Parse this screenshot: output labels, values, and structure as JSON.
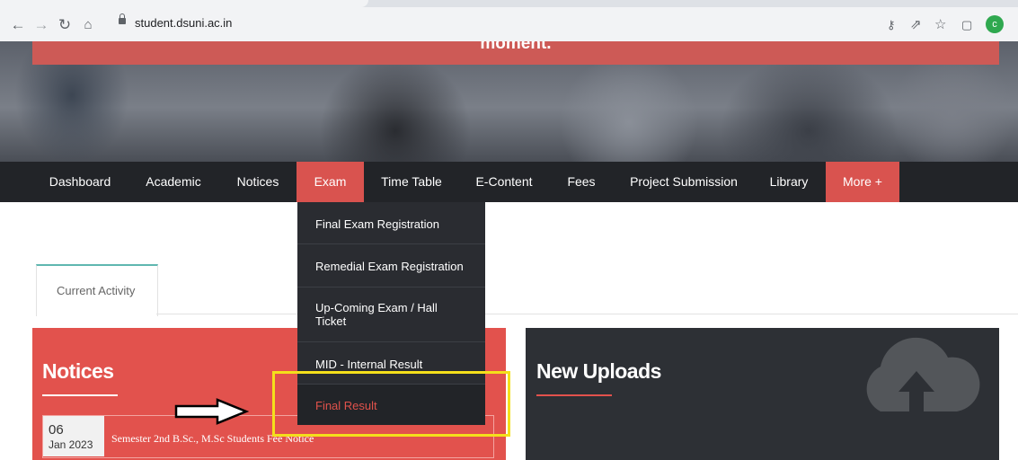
{
  "browser": {
    "url": "student.dsuni.ac.in",
    "nav_icons": [
      "back-arrow-icon",
      "forward-arrow-icon",
      "reload-icon",
      "home-icon"
    ],
    "right_icons": [
      "key-icon",
      "share-icon",
      "star-icon",
      "side-panel-icon"
    ],
    "profile_initial": "c"
  },
  "hero": {
    "title": "moment."
  },
  "nav": {
    "items": [
      "Dashboard",
      "Academic",
      "Notices",
      "Exam",
      "Time Table",
      "E-Content",
      "Fees",
      "Project Submission",
      "Library",
      "More +"
    ],
    "active": "Exam"
  },
  "exam_menu": {
    "items": [
      "Final Exam Registration",
      "Remedial Exam Registration",
      "Up-Coming Exam / Hall",
      "Ticket",
      "MID - Internal Result",
      "Final Result"
    ],
    "highlighted": "Final Result"
  },
  "tabs": {
    "current": "Current Activity"
  },
  "notices": {
    "title": "Notices",
    "items": [
      {
        "day": "06",
        "month": "Jan 2023",
        "text": "Semester 2nd B.Sc., M.Sc Students Fee Notice"
      }
    ]
  },
  "uploads": {
    "title": "New Uploads"
  },
  "colors": {
    "accent_red": "#e2524d",
    "nav_dark": "#222428",
    "highlight_yellow": "#f4df1b",
    "tab_teal": "#5fb7b0"
  }
}
